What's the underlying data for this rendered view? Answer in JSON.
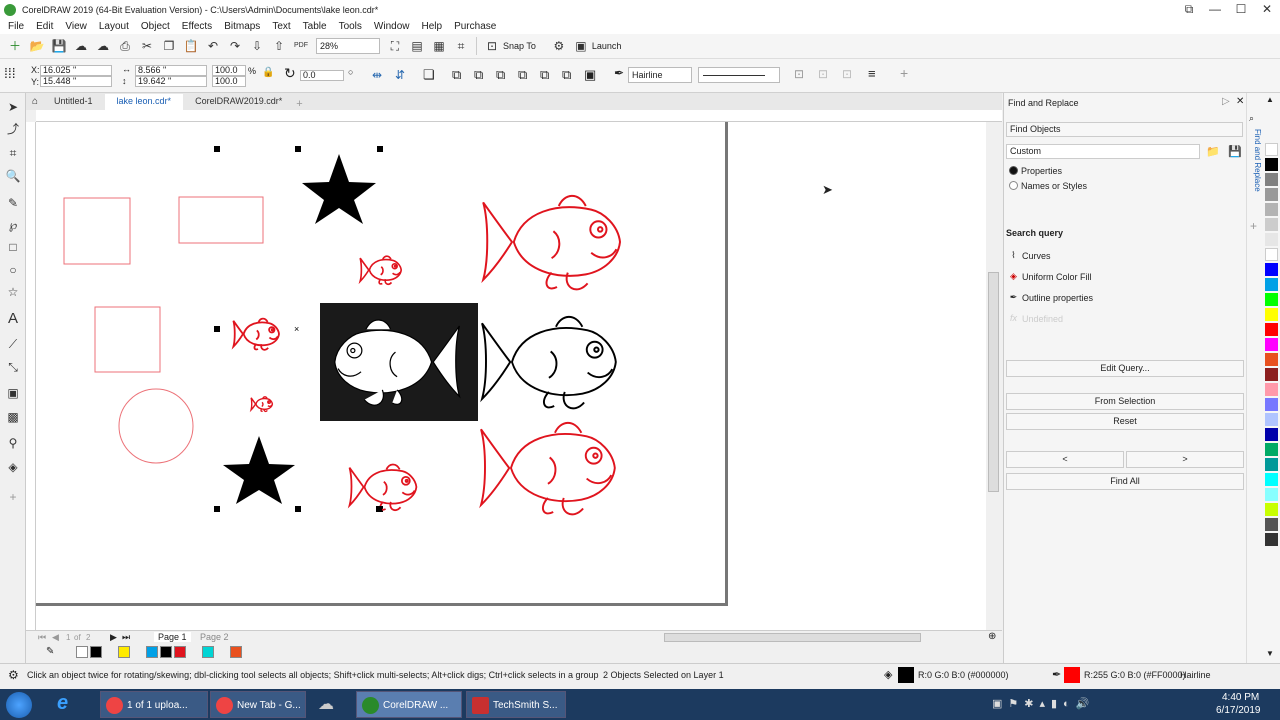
{
  "window": {
    "title": "CorelDRAW 2019 (64-Bit Evaluation Version) - C:\\Users\\Admin\\Documents\\lake leon.cdr*"
  },
  "menu": [
    "File",
    "Edit",
    "View",
    "Layout",
    "Object",
    "Effects",
    "Bitmaps",
    "Text",
    "Table",
    "Tools",
    "Window",
    "Help",
    "Purchase"
  ],
  "toolbar": {
    "zoom": "28%",
    "snap_to": "Snap To",
    "launch": "Launch"
  },
  "propbar": {
    "x": "16.025 \"",
    "y": "15.448 \"",
    "w": "8.566 \"",
    "h": "19.642 \"",
    "sx": "100.0",
    "sy": "100.0",
    "pct": "%",
    "angle": "0.0",
    "outline": "Hairline"
  },
  "doc_tabs": [
    "Untitled-1",
    "lake leon.cdr*",
    "CorelDRAW2019.cdr*"
  ],
  "page_nav": {
    "current": "1",
    "of": "of",
    "total": "2",
    "page1": "Page 1",
    "page2": "Page 2"
  },
  "status": {
    "hint": "Click an object twice for rotating/skewing; dbl-clicking tool selects all objects; Shift+click multi-selects; Alt+click digs; Ctrl+click selects in a group",
    "selection": "2 Objects Selected on Layer 1",
    "fill": "R:0 G:0 B:0 (#000000)",
    "outline": "R:255 G:0 B:0 (#FF0000)",
    "outline_width": "Hairline"
  },
  "docker": {
    "title": "Find and Replace",
    "mode": "Find Objects",
    "preset": "Custom",
    "radio_properties": "Properties",
    "radio_names": "Names or Styles",
    "search_query_label": "Search query",
    "queries": [
      {
        "icon": "curves-icon",
        "label": "Curves"
      },
      {
        "icon": "fill-icon",
        "label": "Uniform Color Fill"
      },
      {
        "icon": "outline-pen-icon",
        "label": "Outline properties"
      },
      {
        "icon": "fx-icon",
        "label": "Undefined"
      }
    ],
    "edit_query": "Edit Query...",
    "from_selection": "From Selection",
    "reset": "Reset",
    "prev": "<",
    "next": ">",
    "find_all": "Find All",
    "side_tab": "Find and Replace"
  },
  "taskbar": {
    "items": [
      "1 of 1 uploa...",
      "New Tab - G...",
      "CorelDRAW ...",
      "TechSmith S..."
    ],
    "time": "4:40 PM",
    "date": "6/17/2019"
  },
  "colors": {
    "accent_red": "#e0141e",
    "palette": [
      "#000000",
      "#ffffff",
      "#0000ff",
      "#00a0e6",
      "#00ff00",
      "#ffff00",
      "#ff0000",
      "#ff00ff",
      "#00ffff",
      "#e8501e",
      "#8c1e1e",
      "#ff99aa",
      "#7777ff",
      "#b0c4ff",
      "#009060",
      "#c8ff00"
    ]
  }
}
